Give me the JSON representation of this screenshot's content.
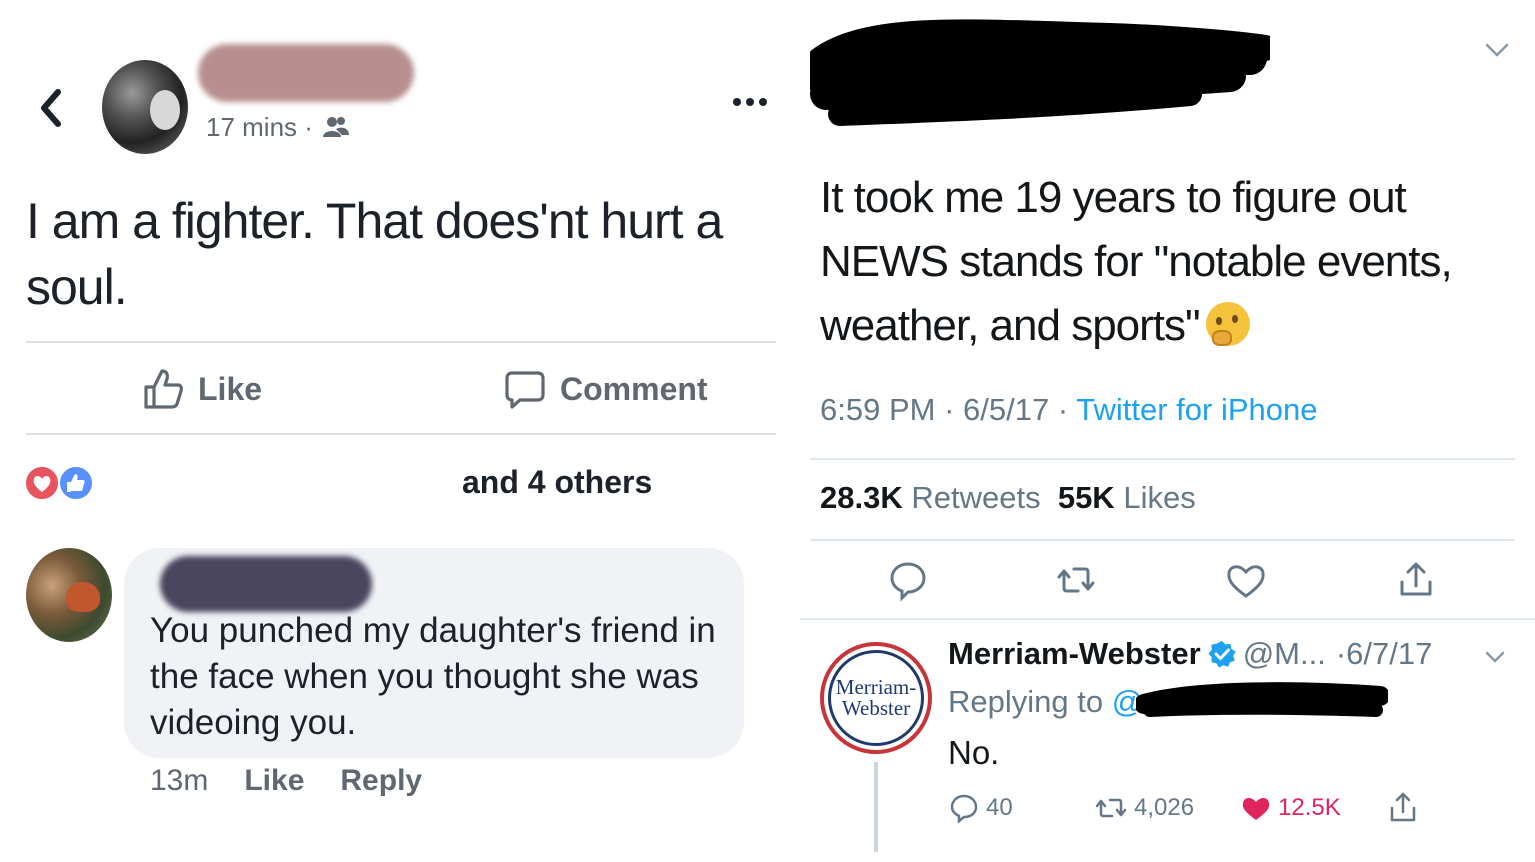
{
  "facebook": {
    "post_time": "17 mins ·",
    "post_text": "I am a fighter.  That does'nt hurt a soul.",
    "actions": {
      "like": "Like",
      "comment": "Comment"
    },
    "reactions_summary": "and 4 others",
    "comment": {
      "text": "You punched my daughter's friend in the face when you thought she was videoing you.",
      "time": "13m",
      "like": "Like",
      "reply": "Reply"
    },
    "colors": {
      "love": "#e8535e",
      "like": "#5890ff",
      "text_secondary": "#606770"
    }
  },
  "twitter": {
    "tweet_text": "It took me 19 years to figure out NEWS stands for \"notable events, weather, and sports\"",
    "emoji": "thinking-face",
    "meta": {
      "time": "6:59 PM",
      "date": "6/5/17",
      "sep": "·",
      "source": "Twitter for iPhone"
    },
    "stats": {
      "retweets_count": "28.3K",
      "retweets_label": "Retweets",
      "likes_count": "55K",
      "likes_label": "Likes"
    },
    "reply": {
      "logo_line1": "Merriam-",
      "logo_line2": "Webster",
      "name": "Merriam-Webster",
      "handle": "@M...",
      "date": "·6/7/17",
      "replying_prefix": "Replying to",
      "replying_at": "@",
      "text": "No.",
      "replies": "40",
      "retweets": "4,026",
      "likes": "12.5K"
    },
    "colors": {
      "link": "#1da1f2",
      "like": "#e0245e",
      "text_secondary": "#657786"
    }
  }
}
